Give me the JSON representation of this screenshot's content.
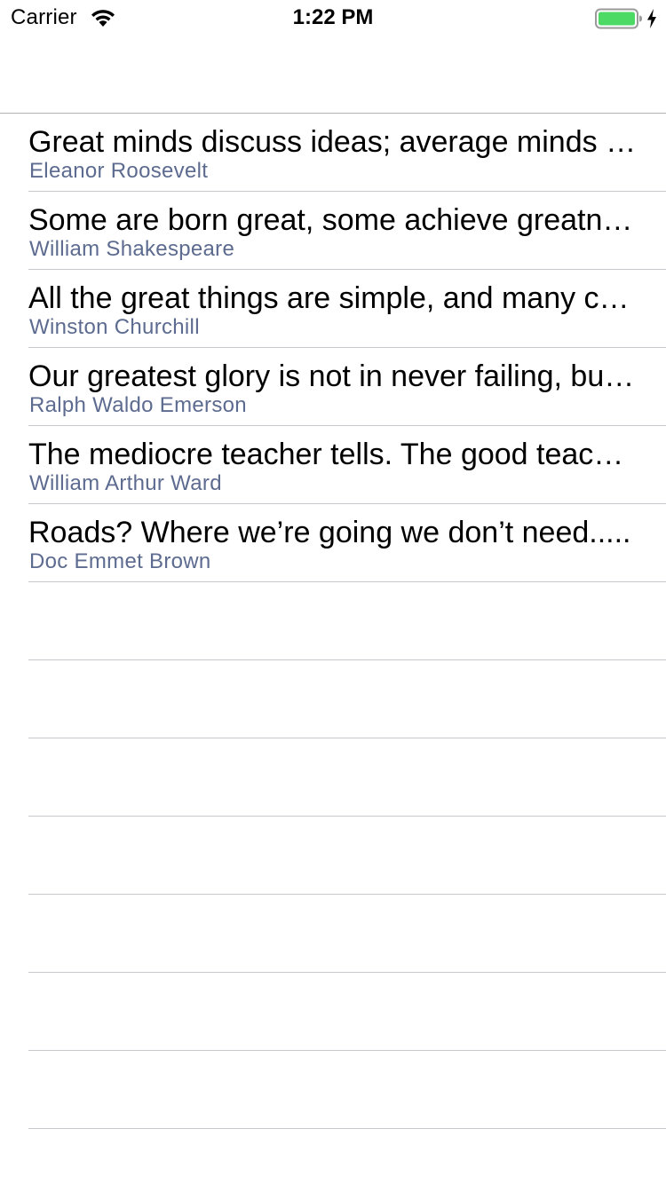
{
  "status_bar": {
    "carrier": "Carrier",
    "time": "1:22 PM",
    "wifi_icon": "wifi-icon",
    "battery_icon": "battery-full-icon",
    "charging_icon": "charging-bolt-icon",
    "battery_color": "#4cd964"
  },
  "colors": {
    "subtitle": "#5c6b8f",
    "separator": "#c8c7cc"
  },
  "quotes": [
    {
      "text": "Great minds discuss ideas; average minds discuss events; small minds discuss people.",
      "author": "Eleanor Roosevelt"
    },
    {
      "text": "Some are born great, some achieve greatness, and some have greatness thrust upon them.",
      "author": "William Shakespeare"
    },
    {
      "text": "All the great things are simple, and many can be expressed in a single word.",
      "author": "Winston Churchill"
    },
    {
      "text": "Our greatest glory is not in never failing, but in rising up every time we fail.",
      "author": "Ralph Waldo Emerson"
    },
    {
      "text": "The mediocre teacher tells. The good teacher explains.",
      "author": "William Arthur Ward"
    },
    {
      "text": "Roads? Where we’re going we don’t need.....",
      "author": "Doc Emmet Brown"
    },
    {
      "text": "",
      "author": ""
    },
    {
      "text": "",
      "author": ""
    },
    {
      "text": "",
      "author": ""
    },
    {
      "text": "",
      "author": ""
    },
    {
      "text": "",
      "author": ""
    },
    {
      "text": "",
      "author": ""
    },
    {
      "text": "",
      "author": ""
    }
  ]
}
